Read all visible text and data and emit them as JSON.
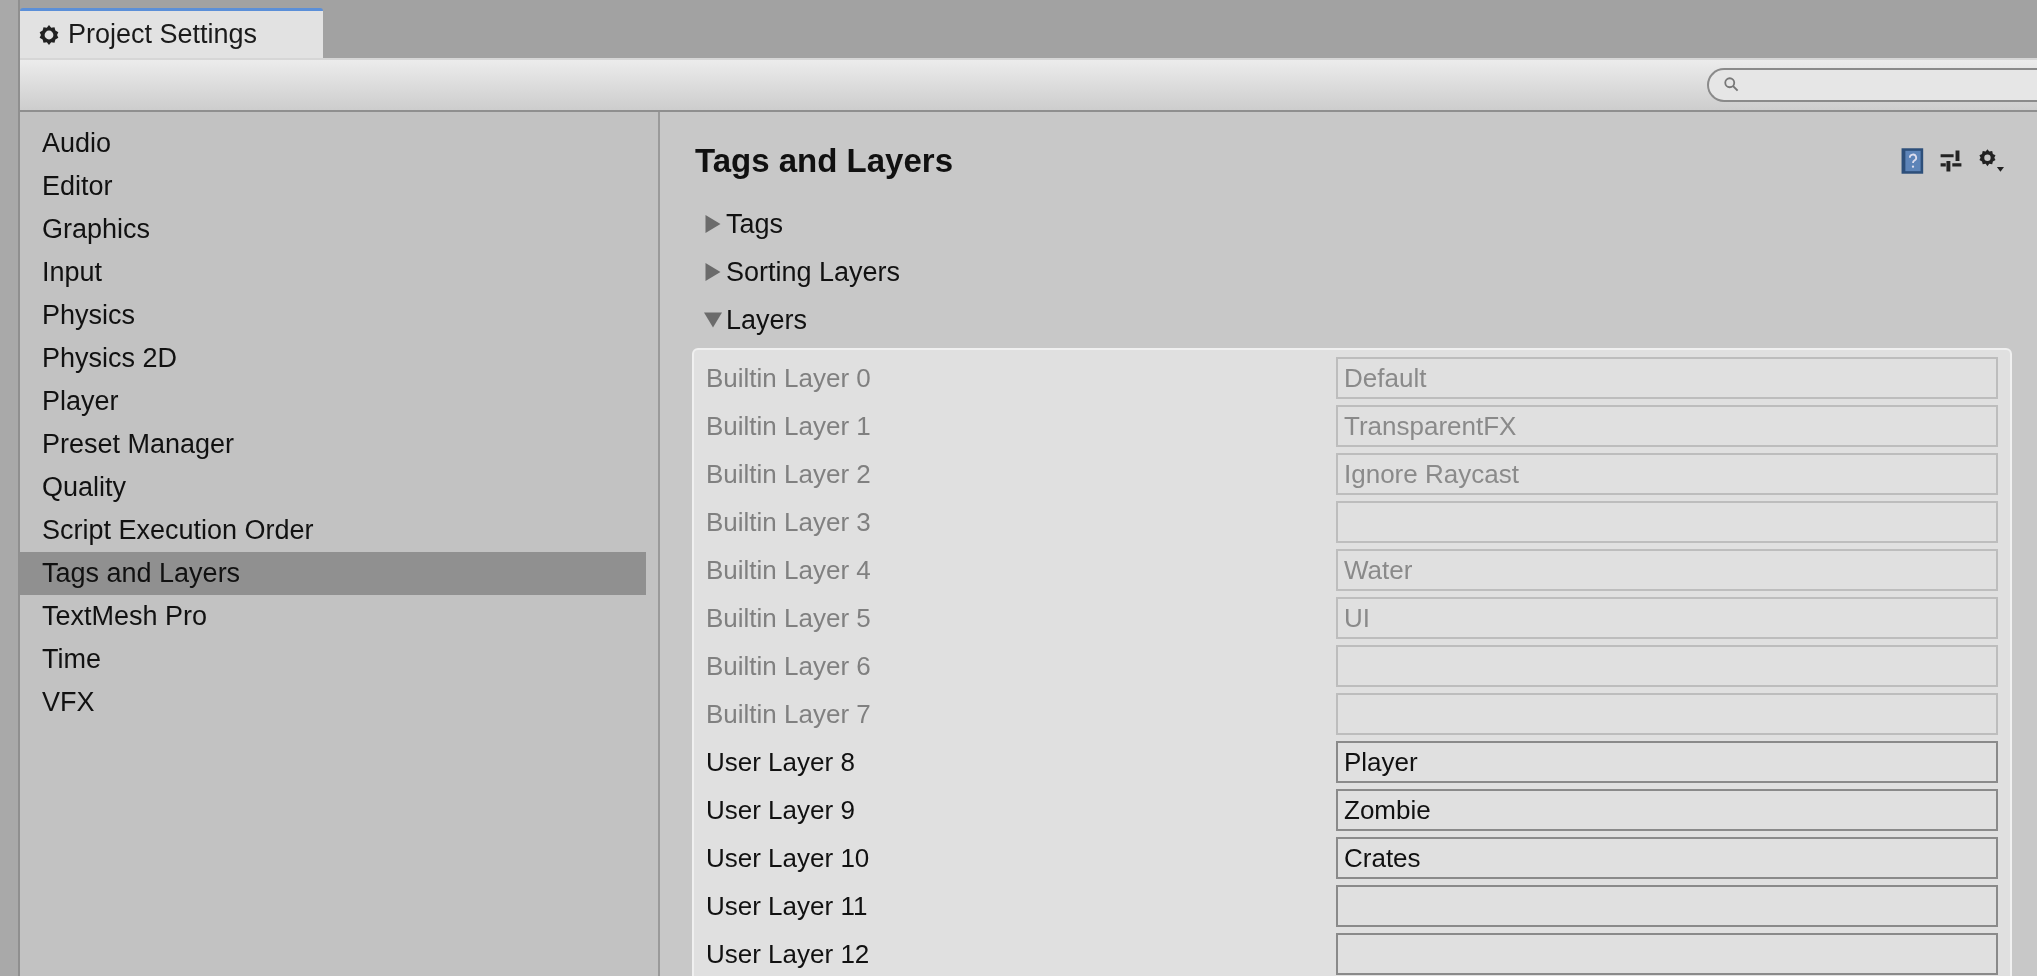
{
  "window": {
    "tab": {
      "title": "Project Settings",
      "selected": true
    }
  },
  "sidebar": {
    "items": [
      {
        "label": "Audio",
        "selected": false
      },
      {
        "label": "Editor",
        "selected": false
      },
      {
        "label": "Graphics",
        "selected": false
      },
      {
        "label": "Input",
        "selected": false
      },
      {
        "label": "Physics",
        "selected": false
      },
      {
        "label": "Physics 2D",
        "selected": false
      },
      {
        "label": "Player",
        "selected": false
      },
      {
        "label": "Preset Manager",
        "selected": false
      },
      {
        "label": "Quality",
        "selected": false
      },
      {
        "label": "Script Execution Order",
        "selected": false
      },
      {
        "label": "Tags and Layers",
        "selected": true
      },
      {
        "label": "TextMesh Pro",
        "selected": false
      },
      {
        "label": "Time",
        "selected": false
      },
      {
        "label": "VFX",
        "selected": false
      }
    ]
  },
  "panel": {
    "title": "Tags and Layers",
    "foldouts": [
      {
        "label": "Tags",
        "expanded": false
      },
      {
        "label": "Sorting Layers",
        "expanded": false
      },
      {
        "label": "Layers",
        "expanded": true
      }
    ],
    "layers": [
      {
        "label": "Builtin Layer 0",
        "value": "Default",
        "disabled": true
      },
      {
        "label": "Builtin Layer 1",
        "value": "TransparentFX",
        "disabled": true
      },
      {
        "label": "Builtin Layer 2",
        "value": "Ignore Raycast",
        "disabled": true
      },
      {
        "label": "Builtin Layer 3",
        "disabled": true
      },
      {
        "label": "Builtin Layer 4",
        "value": "Water",
        "disabled": true
      },
      {
        "label": "Builtin Layer 5",
        "value": "UI",
        "disabled": true
      },
      {
        "label": "Builtin Layer 6",
        "disabled": true
      },
      {
        "label": "Builtin Layer 7",
        "disabled": true
      },
      {
        "label": "User Layer 8",
        "value": "Player",
        "disabled": false
      },
      {
        "label": "User Layer 9",
        "value": "Zombie",
        "disabled": false
      },
      {
        "label": "User Layer 10",
        "value": "Crates",
        "disabled": false
      },
      {
        "label": "User Layer 11",
        "disabled": false
      },
      {
        "label": "User Layer 12",
        "disabled": false
      }
    ]
  }
}
